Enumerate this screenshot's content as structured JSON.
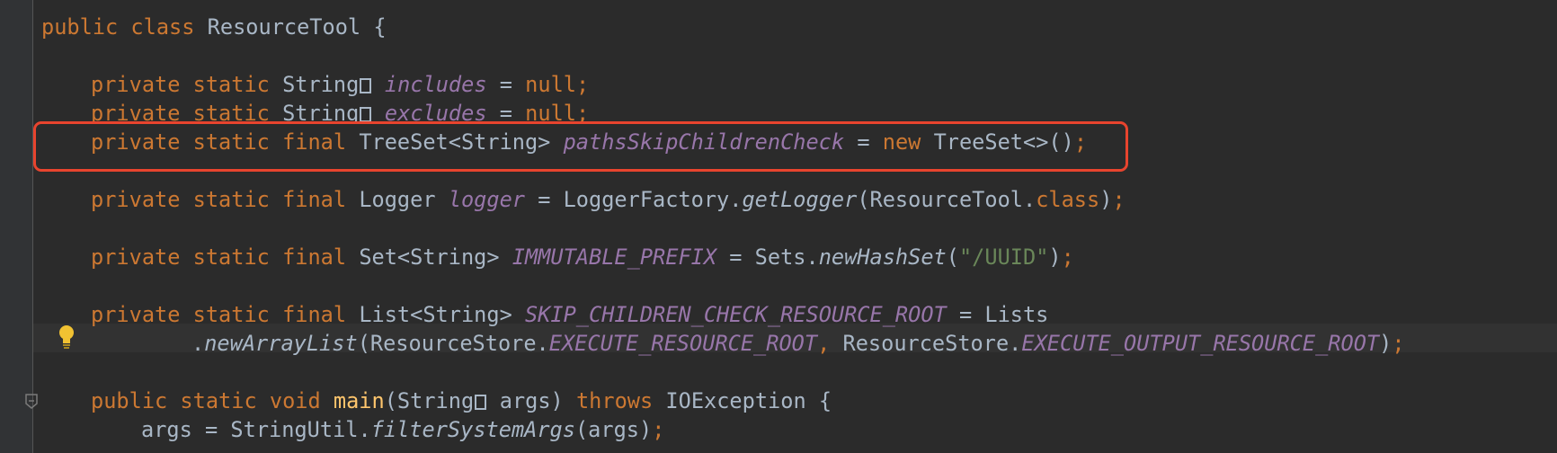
{
  "editor": {
    "theme_colors": {
      "background": "#2b2b2b",
      "keyword": "#cc7832",
      "field": "#9876aa",
      "string": "#6a8759",
      "method_decl": "#ffc66d",
      "text": "#a9b7c6",
      "highlight_box": "#e8442e"
    },
    "lines": [
      {
        "tokens": [
          {
            "t": "kw",
            "v": "public class "
          },
          {
            "t": "plain",
            "v": "ResourceTool {"
          }
        ]
      },
      {
        "tokens": [
          {
            "t": "kw",
            "v": "private static "
          },
          {
            "t": "plain",
            "v": "String"
          },
          {
            "t": "brk",
            "v": ""
          },
          {
            "t": "plain",
            "v": " "
          },
          {
            "t": "field",
            "v": "includes"
          },
          {
            "t": "plain",
            "v": " = "
          },
          {
            "t": "kw",
            "v": "null"
          },
          {
            "t": "kw",
            "v": ";"
          }
        ]
      },
      {
        "tokens": [
          {
            "t": "kw",
            "v": "private static "
          },
          {
            "t": "plain",
            "v": "String"
          },
          {
            "t": "brk",
            "v": ""
          },
          {
            "t": "plain",
            "v": " "
          },
          {
            "t": "field",
            "v": "excludes"
          },
          {
            "t": "plain",
            "v": " = "
          },
          {
            "t": "kw",
            "v": "null"
          },
          {
            "t": "kw",
            "v": ";"
          }
        ]
      },
      {
        "tokens": [
          {
            "t": "kw",
            "v": "private static final "
          },
          {
            "t": "plain",
            "v": "TreeSet<String> "
          },
          {
            "t": "field",
            "v": "pathsSkipChildrenCheck"
          },
          {
            "t": "plain",
            "v": " = "
          },
          {
            "t": "kw",
            "v": "new "
          },
          {
            "t": "plain",
            "v": "TreeSet<>()"
          },
          {
            "t": "kw",
            "v": ";"
          }
        ]
      },
      {
        "tokens": [
          {
            "t": "kw",
            "v": "private static final "
          },
          {
            "t": "plain",
            "v": "Logger "
          },
          {
            "t": "field",
            "v": "logger"
          },
          {
            "t": "plain",
            "v": " = LoggerFactory."
          },
          {
            "t": "smethod",
            "v": "getLogger"
          },
          {
            "t": "plain",
            "v": "(ResourceTool."
          },
          {
            "t": "kw",
            "v": "class"
          },
          {
            "t": "plain",
            "v": ")"
          },
          {
            "t": "kw",
            "v": ";"
          }
        ]
      },
      {
        "tokens": [
          {
            "t": "kw",
            "v": "private static final "
          },
          {
            "t": "plain",
            "v": "Set<String> "
          },
          {
            "t": "field",
            "v": "IMMUTABLE_PREFIX"
          },
          {
            "t": "plain",
            "v": " = Sets."
          },
          {
            "t": "smethod",
            "v": "newHashSet"
          },
          {
            "t": "plain",
            "v": "("
          },
          {
            "t": "str",
            "v": "\"/UUID\""
          },
          {
            "t": "plain",
            "v": ")"
          },
          {
            "t": "kw",
            "v": ";"
          }
        ]
      },
      {
        "tokens": [
          {
            "t": "kw",
            "v": "private static final "
          },
          {
            "t": "plain",
            "v": "List<String> "
          },
          {
            "t": "field",
            "v": "SKIP_CHILDREN_CHECK_RESOURCE_ROOT"
          },
          {
            "t": "plain",
            "v": " = Lists"
          }
        ]
      },
      {
        "tokens": [
          {
            "t": "plain",
            "v": "."
          },
          {
            "t": "smethod",
            "v": "newArrayList"
          },
          {
            "t": "plain",
            "v": "(ResourceStore."
          },
          {
            "t": "field",
            "v": "EXECUTE_RESOURCE_ROOT"
          },
          {
            "t": "kw",
            "v": ", "
          },
          {
            "t": "plain",
            "v": "ResourceStore."
          },
          {
            "t": "field",
            "v": "EXECUTE_OUTPUT_RESOURCE_ROOT"
          },
          {
            "t": "plain",
            "v": ")"
          },
          {
            "t": "kw",
            "v": ";"
          }
        ]
      },
      {
        "tokens": [
          {
            "t": "kw",
            "v": "public static void "
          },
          {
            "t": "fn",
            "v": "main"
          },
          {
            "t": "plain",
            "v": "(String"
          },
          {
            "t": "brk",
            "v": ""
          },
          {
            "t": "plain",
            "v": " args) "
          },
          {
            "t": "kw",
            "v": "throws "
          },
          {
            "t": "plain",
            "v": "IOException {"
          }
        ]
      },
      {
        "tokens": [
          {
            "t": "plain",
            "v": "args = StringUtil."
          },
          {
            "t": "smethod",
            "v": "filterSystemArgs"
          },
          {
            "t": "plain",
            "v": "(args)"
          },
          {
            "t": "kw",
            "v": ";"
          }
        ]
      }
    ]
  }
}
